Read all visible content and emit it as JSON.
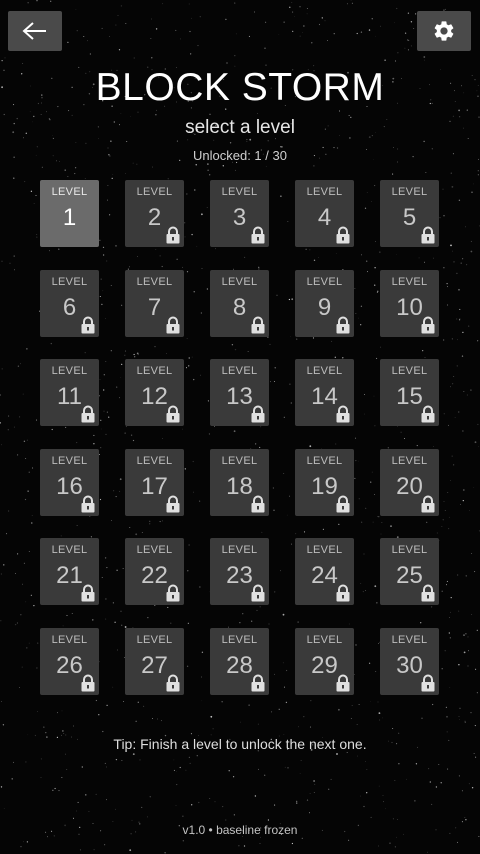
{
  "header": {
    "title": "BLOCK STORM",
    "subtitle": "select a level",
    "unlocked_text": "Unlocked: 1 / 30"
  },
  "buttons": {
    "back_icon": "arrow-left-icon",
    "settings_icon": "gear-icon"
  },
  "level_label": "LEVEL",
  "levels": [
    {
      "number": "1",
      "locked": false
    },
    {
      "number": "2",
      "locked": true
    },
    {
      "number": "3",
      "locked": true
    },
    {
      "number": "4",
      "locked": true
    },
    {
      "number": "5",
      "locked": true
    },
    {
      "number": "6",
      "locked": true
    },
    {
      "number": "7",
      "locked": true
    },
    {
      "number": "8",
      "locked": true
    },
    {
      "number": "9",
      "locked": true
    },
    {
      "number": "10",
      "locked": true
    },
    {
      "number": "11",
      "locked": true
    },
    {
      "number": "12",
      "locked": true
    },
    {
      "number": "13",
      "locked": true
    },
    {
      "number": "14",
      "locked": true
    },
    {
      "number": "15",
      "locked": true
    },
    {
      "number": "16",
      "locked": true
    },
    {
      "number": "17",
      "locked": true
    },
    {
      "number": "18",
      "locked": true
    },
    {
      "number": "19",
      "locked": true
    },
    {
      "number": "20",
      "locked": true
    },
    {
      "number": "21",
      "locked": true
    },
    {
      "number": "22",
      "locked": true
    },
    {
      "number": "23",
      "locked": true
    },
    {
      "number": "24",
      "locked": true
    },
    {
      "number": "25",
      "locked": true
    },
    {
      "number": "26",
      "locked": true
    },
    {
      "number": "27",
      "locked": true
    },
    {
      "number": "28",
      "locked": true
    },
    {
      "number": "29",
      "locked": true
    },
    {
      "number": "30",
      "locked": true
    }
  ],
  "footer": {
    "tip": "Tip: Finish a level to unlock the next one.",
    "version": "v1.0 • baseline frozen"
  },
  "colors": {
    "background": "#050505",
    "button": "#4a4a4a",
    "tile_locked": "#3a3a3a",
    "tile_unlocked": "#6b6b6b"
  }
}
